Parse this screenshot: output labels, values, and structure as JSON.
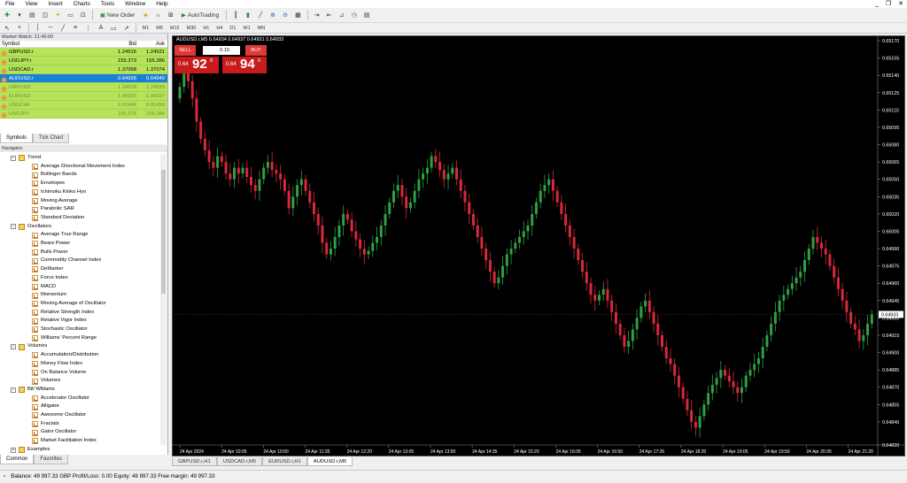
{
  "menu": [
    "File",
    "View",
    "Insert",
    "Charts",
    "Tools",
    "Window",
    "Help"
  ],
  "window_controls": {
    "minimize": "_",
    "restore": "❐",
    "close": "✕"
  },
  "toolbar": {
    "new_order": "New Order",
    "autotrading": "AutoTrading"
  },
  "timeframes": [
    "M1",
    "M5",
    "M15",
    "M30",
    "H1",
    "H4",
    "D1",
    "W1",
    "MN"
  ],
  "market_watch": {
    "title": "Market Watch: 21:46:00",
    "headers": {
      "symbol": "Symbol",
      "bid": "Bid",
      "ask": "Ask"
    },
    "rows": [
      {
        "symbol": "GBPUSD.r",
        "bid": "1.24516",
        "ask": "1.24531",
        "selected": false,
        "dim": false
      },
      {
        "symbol": "USDJPY.r",
        "bid": "155.273",
        "ask": "155.286",
        "selected": false,
        "dim": false
      },
      {
        "symbol": "USDCAD.r",
        "bid": "1.37058",
        "ask": "1.37074",
        "selected": false,
        "dim": false
      },
      {
        "symbol": "AUDUSD.r",
        "bid": "0.64928",
        "ask": "0.64940",
        "selected": true,
        "dim": false
      },
      {
        "symbol": "GBPUSD",
        "bid": "1.24518",
        "ask": "1.24529",
        "selected": false,
        "dim": true
      },
      {
        "symbol": "EURUSD",
        "bid": "1.06920",
        "ask": "1.06927",
        "selected": false,
        "dim": true
      },
      {
        "symbol": "USDCHF",
        "bid": "0.91449",
        "ask": "0.91459",
        "selected": false,
        "dim": true
      },
      {
        "symbol": "USDJPY",
        "bid": "155.275",
        "ask": "155.284",
        "selected": false,
        "dim": true
      }
    ],
    "tabs": [
      "Symbols",
      "Tick Chart"
    ]
  },
  "navigator": {
    "title": "Navigator",
    "tree": [
      {
        "label": "Trend",
        "level": 1,
        "type": "folder"
      },
      {
        "label": "Average Directional Movement Index",
        "level": 2,
        "type": "ind"
      },
      {
        "label": "Bollinger Bands",
        "level": 2,
        "type": "ind"
      },
      {
        "label": "Envelopes",
        "level": 2,
        "type": "ind"
      },
      {
        "label": "Ichimoku Kinko Hyo",
        "level": 2,
        "type": "ind"
      },
      {
        "label": "Moving Average",
        "level": 2,
        "type": "ind"
      },
      {
        "label": "Parabolic SAR",
        "level": 2,
        "type": "ind"
      },
      {
        "label": "Standard Deviation",
        "level": 2,
        "type": "ind"
      },
      {
        "label": "Oscillators",
        "level": 1,
        "type": "folder"
      },
      {
        "label": "Average True Range",
        "level": 2,
        "type": "ind"
      },
      {
        "label": "Bears Power",
        "level": 2,
        "type": "ind"
      },
      {
        "label": "Bulls Power",
        "level": 2,
        "type": "ind"
      },
      {
        "label": "Commodity Channel Index",
        "level": 2,
        "type": "ind"
      },
      {
        "label": "DeMarker",
        "level": 2,
        "type": "ind"
      },
      {
        "label": "Force Index",
        "level": 2,
        "type": "ind"
      },
      {
        "label": "MACD",
        "level": 2,
        "type": "ind"
      },
      {
        "label": "Momentum",
        "level": 2,
        "type": "ind"
      },
      {
        "label": "Moving Average of Oscillator",
        "level": 2,
        "type": "ind"
      },
      {
        "label": "Relative Strength Index",
        "level": 2,
        "type": "ind"
      },
      {
        "label": "Relative Vigor Index",
        "level": 2,
        "type": "ind"
      },
      {
        "label": "Stochastic Oscillator",
        "level": 2,
        "type": "ind"
      },
      {
        "label": "Williams' Percent Range",
        "level": 2,
        "type": "ind"
      },
      {
        "label": "Volumes",
        "level": 1,
        "type": "folder"
      },
      {
        "label": "Accumulation/Distribution",
        "level": 2,
        "type": "ind"
      },
      {
        "label": "Money Flow Index",
        "level": 2,
        "type": "ind"
      },
      {
        "label": "On Balance Volume",
        "level": 2,
        "type": "ind"
      },
      {
        "label": "Volumes",
        "level": 2,
        "type": "ind"
      },
      {
        "label": "Bill Williams",
        "level": 1,
        "type": "folder"
      },
      {
        "label": "Accelerator Oscillator",
        "level": 2,
        "type": "ind"
      },
      {
        "label": "Alligator",
        "level": 2,
        "type": "ind"
      },
      {
        "label": "Awesome Oscillator",
        "level": 2,
        "type": "ind"
      },
      {
        "label": "Fractals",
        "level": 2,
        "type": "ind"
      },
      {
        "label": "Gator Oscillator",
        "level": 2,
        "type": "ind"
      },
      {
        "label": "Market Facilitation Index",
        "level": 2,
        "type": "ind"
      },
      {
        "label": "Examples",
        "level": 1,
        "type": "folder"
      }
    ],
    "tabs": [
      "Common",
      "Favorites"
    ]
  },
  "chart": {
    "header": "AUDUSD.r,M5  0.64934 0.64937 0.64931 0.64933",
    "trade_panel": {
      "sell": "SELL",
      "buy": "BUY",
      "volume": "0.10",
      "sell_small": "0.64",
      "sell_big": "92",
      "sell_sup": "8",
      "buy_small": "0.64",
      "buy_big": "94",
      "buy_sup": "0"
    },
    "current_price": "0.64933",
    "colors": {
      "bull": "#2ea043",
      "bear": "#d8283c",
      "background": "#000000",
      "axis_text": "#ffffff"
    }
  },
  "chart_tabs": [
    {
      "label": "GBPUSD.r,H1",
      "active": false
    },
    {
      "label": "USDCAD.r,M5",
      "active": false
    },
    {
      "label": "EURUSD.r,H1",
      "active": false
    },
    {
      "label": "AUDUSD.r,M5",
      "active": true
    }
  ],
  "status_bar": {
    "text": "Balance: 49 997.33 GBP  Profit/Loss: 0.00  Equity: 49 997.33  Free margin: 49 997.33"
  },
  "chart_data": {
    "type": "candlestick",
    "symbol": "AUDUSD.r",
    "timeframe": "M5",
    "y_ticks": [
      "0.65170",
      "0.65155",
      "0.65140",
      "0.65125",
      "0.65110",
      "0.65095",
      "0.65080",
      "0.65065",
      "0.65050",
      "0.65035",
      "0.65020",
      "0.65005",
      "0.64990",
      "0.64975",
      "0.64960",
      "0.64945",
      "0.64930",
      "0.64915",
      "0.64900",
      "0.64885",
      "0.64870",
      "0.64855",
      "0.64840",
      "0.64820"
    ],
    "x_ticks": [
      "24 Apr 2024",
      "24 Apr 10:05",
      "24 Apr 10:50",
      "24 Apr 11:35",
      "24 Apr 12:20",
      "24 Apr 13:05",
      "24 Apr 13:50",
      "24 Apr 14:35",
      "24 Apr 15:20",
      "24 Apr 16:05",
      "24 Apr 16:50",
      "24 Apr 17:35",
      "24 Apr 18:20",
      "24 Apr 19:05",
      "24 Apr 19:50",
      "24 Apr 20:35",
      "24 Apr 21:20"
    ],
    "closes": [
      0.6513,
      0.65145,
      0.65135,
      0.6512,
      0.651,
      0.65085,
      0.65075,
      0.65065,
      0.6506,
      0.6507,
      0.65065,
      0.65055,
      0.6505,
      0.6506,
      0.65055,
      0.6506,
      0.65052,
      0.65045,
      0.6504,
      0.6505,
      0.6506,
      0.65065,
      0.65058,
      0.65055,
      0.6505,
      0.6504,
      0.65025,
      0.65035,
      0.65045,
      0.6505,
      0.6504,
      0.6503,
      0.6502,
      0.6501,
      0.64995,
      0.64985,
      0.6499,
      0.65,
      0.6501,
      0.6502,
      0.65015,
      0.65005,
      0.64998,
      0.6499,
      0.64985,
      0.64988,
      0.64995,
      0.65,
      0.6501,
      0.6502,
      0.6503,
      0.6504,
      0.65045,
      0.65035,
      0.65025,
      0.6503,
      0.6504,
      0.6505,
      0.65055,
      0.6506,
      0.6507,
      0.65065,
      0.65058,
      0.6505,
      0.65055,
      0.6506,
      0.6505,
      0.6504,
      0.6503,
      0.6502,
      0.6501,
      0.65,
      0.6499,
      0.6498,
      0.6497,
      0.6496,
      0.64965,
      0.64975,
      0.64985,
      0.6499,
      0.64995,
      0.65,
      0.65005,
      0.6501,
      0.6502,
      0.6503,
      0.6504,
      0.65045,
      0.6505,
      0.6504,
      0.6503,
      0.6502,
      0.6501,
      0.65,
      0.6499,
      0.6498,
      0.6497,
      0.6496,
      0.6495,
      0.64945,
      0.6495,
      0.64955,
      0.64945,
      0.64935,
      0.64925,
      0.64915,
      0.64905,
      0.6491,
      0.6492,
      0.6493,
      0.6494,
      0.64945,
      0.64935,
      0.64925,
      0.64915,
      0.64905,
      0.64895,
      0.6489,
      0.6488,
      0.6487,
      0.6486,
      0.6485,
      0.6484,
      0.64835,
      0.64845,
      0.64855,
      0.64865,
      0.64872,
      0.64878,
      0.64885,
      0.6488,
      0.64875,
      0.6487,
      0.64865,
      0.6487,
      0.6488,
      0.64885,
      0.6489,
      0.64895,
      0.64905,
      0.64915,
      0.64925,
      0.64935,
      0.64945,
      0.6495,
      0.64955,
      0.6496,
      0.64965,
      0.6497,
      0.6498,
      0.6499,
      0.65,
      0.64995,
      0.6499,
      0.64985,
      0.64975,
      0.64965,
      0.64955,
      0.64945,
      0.64935,
      0.64925,
      0.6492,
      0.6491,
      0.64915,
      0.64925,
      0.64933
    ]
  }
}
